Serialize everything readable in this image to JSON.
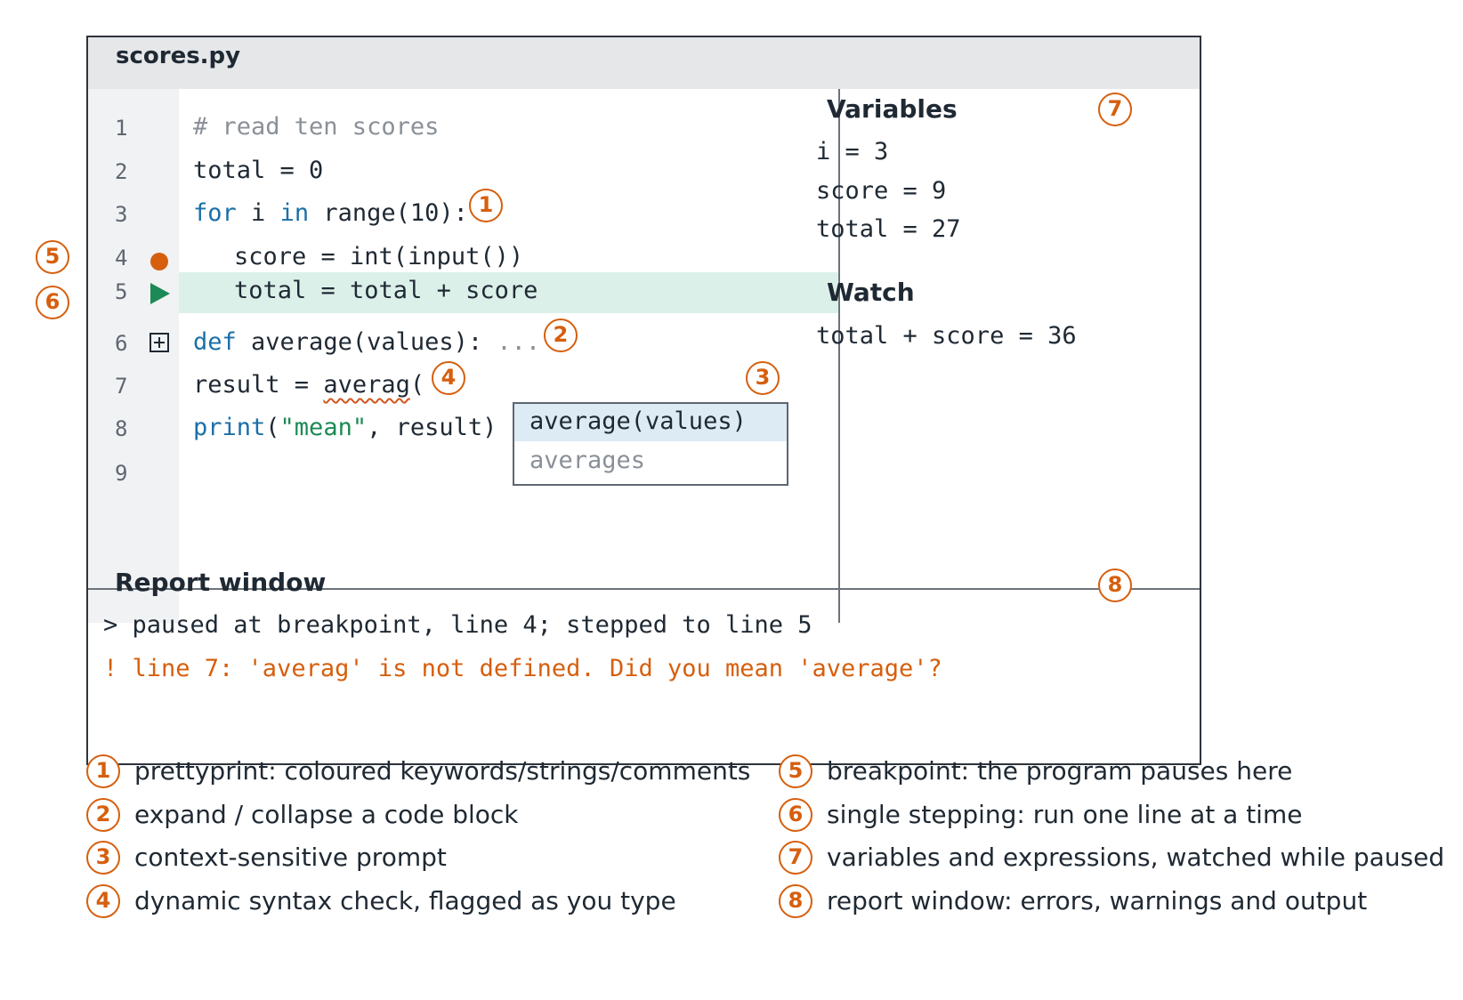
{
  "window": {
    "title": "scores.py"
  },
  "code_lines": [
    {
      "no": "1",
      "text": "# read ten scores"
    },
    {
      "no": "2",
      "text": "total = 0"
    },
    {
      "no": "3",
      "kw1": "for",
      "mid1": " i ",
      "kw2": "in",
      "rest": " range(10):"
    },
    {
      "no": "4",
      "text": "score = int(input())"
    },
    {
      "no": "5",
      "text": "total = total + score"
    },
    {
      "no": "6",
      "kw": "def",
      "rest": " average(values): ",
      "dots": "..."
    },
    {
      "no": "7",
      "pre": "result = ",
      "typo": "averag",
      "post": "("
    },
    {
      "no": "8",
      "kw": "print",
      "open": "(",
      "str": "\"mean\"",
      "rest": ", result)"
    },
    {
      "no": "9",
      "text": ""
    }
  ],
  "autocomplete": {
    "selected": "average(values)",
    "other": "averages"
  },
  "variables": {
    "heading": "Variables",
    "items": [
      "i = 3",
      "score = 9",
      "total = 27"
    ]
  },
  "watch": {
    "heading": "Watch",
    "items": [
      "total + score = 36"
    ]
  },
  "report": {
    "heading": "Report window",
    "message": "> paused at breakpoint, line 4; stepped to line 5",
    "error": "! line 7: 'averag' is not defined. Did you mean 'average'?"
  },
  "badges": [
    "1",
    "2",
    "3",
    "4",
    "5",
    "6",
    "7",
    "8"
  ],
  "legend": [
    {
      "num": "1",
      "text": "prettyprint: coloured keywords/strings/comments"
    },
    {
      "num": "2",
      "text": "expand / collapse a code block"
    },
    {
      "num": "3",
      "text": "context-sensitive prompt"
    },
    {
      "num": "4",
      "text": "dynamic syntax check, flagged as you type"
    },
    {
      "num": "5",
      "text": "breakpoint: the program pauses here"
    },
    {
      "num": "6",
      "text": "single stepping: run one line at a time"
    },
    {
      "num": "7",
      "text": "variables and expressions, watched while paused"
    },
    {
      "num": "8",
      "text": "report window: errors, warnings and output"
    }
  ],
  "colors": {
    "accent": "#d65f0e",
    "keyword": "#1b6fa8",
    "string": "#1b8a55",
    "comment": "#8a9098",
    "current_line": "#dcf0ea",
    "step_arrow": "#1b8a55"
  }
}
